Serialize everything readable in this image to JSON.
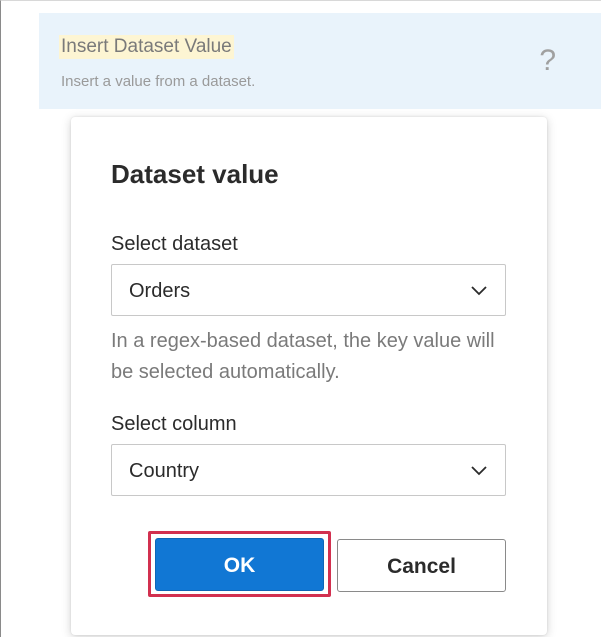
{
  "header": {
    "title": "Insert Dataset Value",
    "subtitle": "Insert a value from a dataset.",
    "help_icon": "?"
  },
  "dialog": {
    "title": "Dataset value",
    "dataset_field": {
      "label": "Select dataset",
      "value": "Orders"
    },
    "helper_text": "In a regex-based dataset, the key value will be selected automatically.",
    "column_field": {
      "label": "Select column",
      "value": "Country"
    },
    "ok_label": "OK",
    "cancel_label": "Cancel"
  },
  "colors": {
    "header_bg": "#e9f3fb",
    "title_highlight": "#fdf5d3",
    "primary_button": "#1177d4",
    "focus_outline": "#d2304f"
  },
  "icons": {
    "help": "question-mark-icon",
    "dropdown": "chevron-down-icon"
  }
}
